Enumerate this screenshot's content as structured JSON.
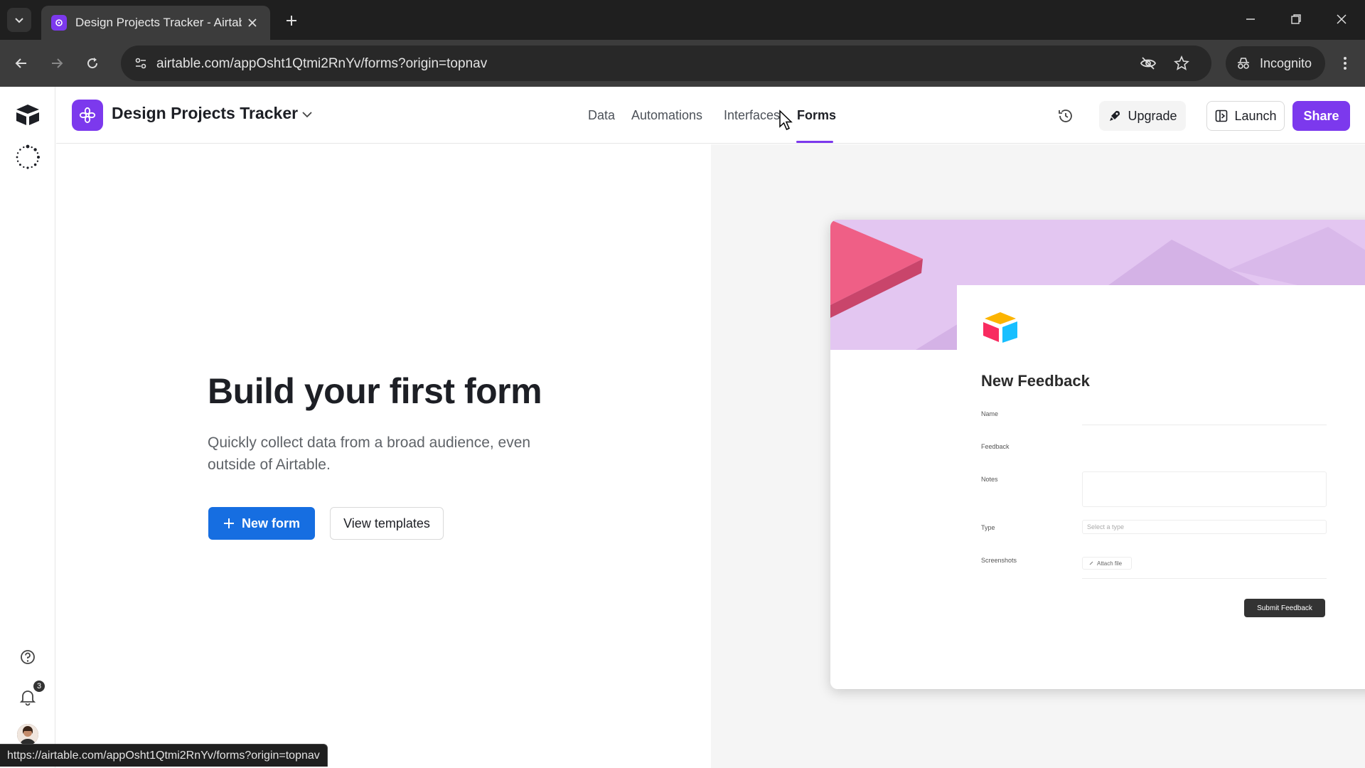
{
  "browser": {
    "tab_title": "Design Projects Tracker - Airtab",
    "url": "airtable.com/appOsht1Qtmi2RnYv/forms?origin=topnav",
    "incognito_label": "Incognito",
    "status_url": "https://airtable.com/appOsht1Qtmi2RnYv/forms?origin=topnav"
  },
  "header": {
    "base_name": "Design Projects Tracker",
    "nav": [
      {
        "label": "Data"
      },
      {
        "label": "Automations"
      },
      {
        "label": "Interfaces"
      },
      {
        "label": "Forms",
        "active": true
      }
    ],
    "upgrade_label": "Upgrade",
    "launch_label": "Launch",
    "share_label": "Share"
  },
  "leftbar": {
    "notification_count": "3"
  },
  "hero": {
    "title": "Build your first form",
    "description": "Quickly collect data from a broad audience, even outside of Airtable.",
    "new_form_label": "New form",
    "view_templates_label": "View templates"
  },
  "preview": {
    "form_title": "New Feedback",
    "fields": [
      {
        "label": "Name"
      },
      {
        "label": "Feedback"
      },
      {
        "label": "Notes"
      },
      {
        "label": "Type",
        "placeholder": "Select a type"
      },
      {
        "label": "Screenshots",
        "button": "Attach file"
      }
    ],
    "submit_label": "Submit Feedback"
  },
  "colors": {
    "accent_purple": "#7c39ed",
    "primary_blue": "#166ee1",
    "banner_lavender": "#e3c6f1"
  }
}
